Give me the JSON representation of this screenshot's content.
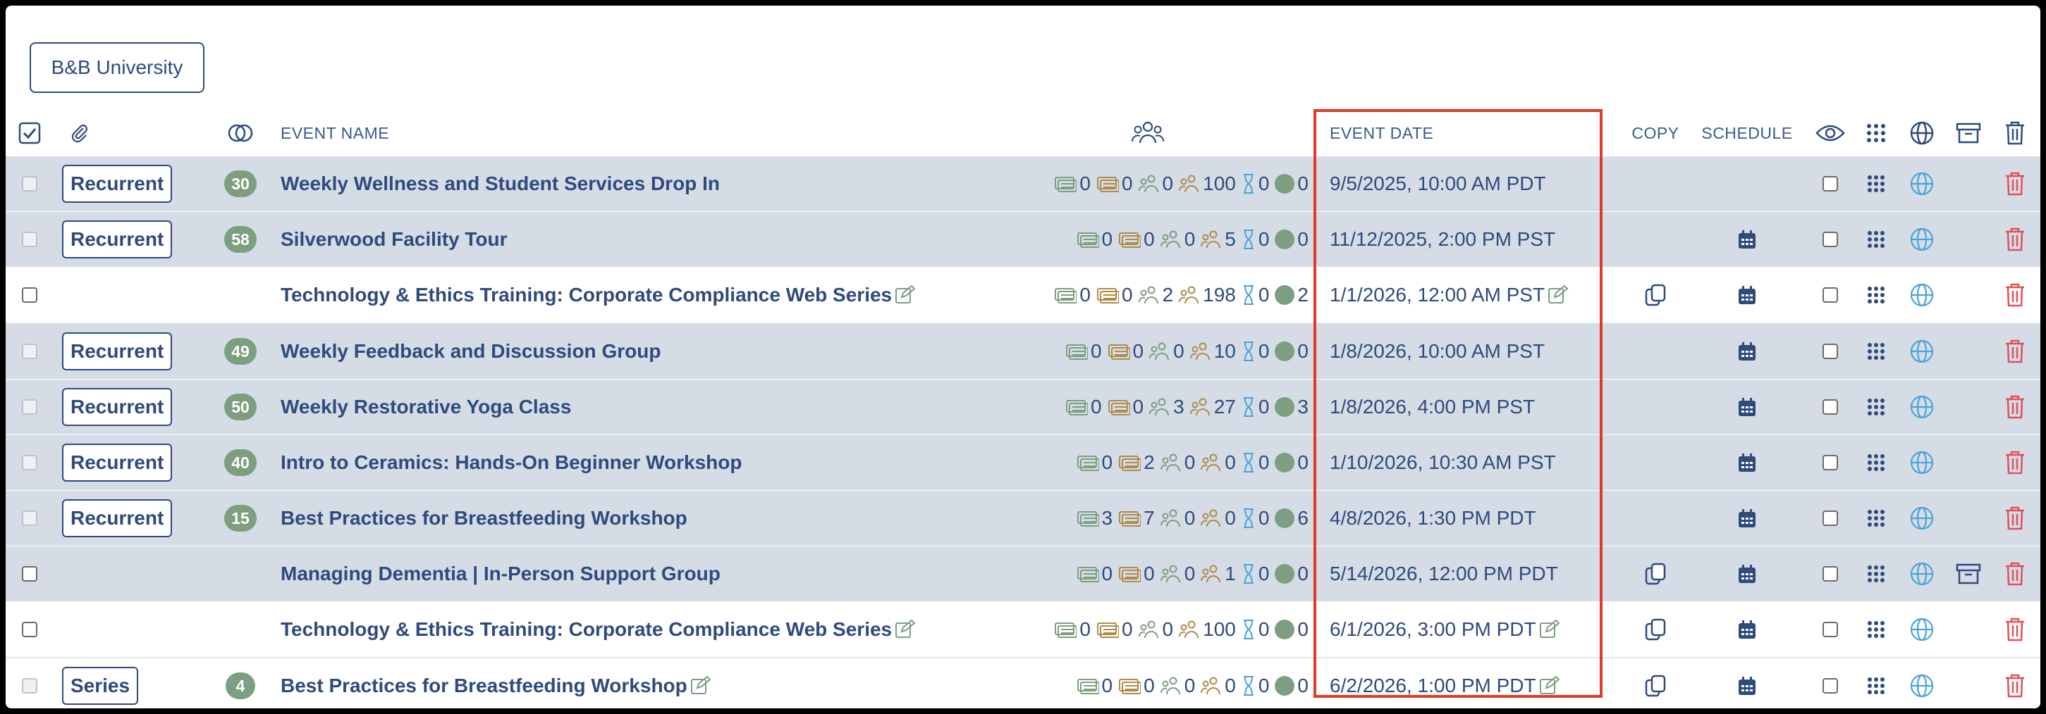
{
  "org_button": "B&B University",
  "header": {
    "event_name": "EVENT NAME",
    "event_date": "EVENT DATE",
    "copy": "COPY",
    "schedule": "SCHEDULE"
  },
  "colors": {
    "primary": "#2f4a7d",
    "row_shaded": "#d5dce6",
    "badge_green": "#7d9e80",
    "highlight_red": "#e03a24",
    "trash_red": "#e0505a",
    "globe_blue": "#4aa3d8"
  },
  "icons": [
    "select-all-checkbox-icon",
    "paperclip-icon",
    "linked-circles-icon",
    "users-icon",
    "ticket-icon",
    "attendee-icon",
    "hourglass-icon",
    "edit-icon",
    "copy-icon",
    "calendar-icon",
    "eye-icon",
    "grid-dots-icon",
    "globe-icon",
    "archive-icon",
    "trash-icon"
  ],
  "rows": [
    {
      "type": "Recurrent",
      "count": "30",
      "name": "Weekly Wellness and Student Services Drop In",
      "name_edit": false,
      "stats": [
        "0",
        "0",
        "0",
        "100",
        "0",
        "0"
      ],
      "date": "9/5/2025, 10:00 AM PDT",
      "date_edit": false,
      "copy": false,
      "schedule": false,
      "archive": false,
      "shaded": true,
      "dim_check": true
    },
    {
      "type": "Recurrent",
      "count": "58",
      "name": "Silverwood Facility Tour",
      "name_edit": false,
      "stats": [
        "0",
        "0",
        "0",
        "5",
        "0",
        "0"
      ],
      "date": "11/12/2025, 2:00 PM PST",
      "date_edit": false,
      "copy": false,
      "schedule": true,
      "archive": false,
      "shaded": true,
      "dim_check": true
    },
    {
      "type": "",
      "count": "",
      "name": "Technology & Ethics Training: Corporate Compliance Web Series",
      "name_edit": true,
      "stats": [
        "0",
        "0",
        "2",
        "198",
        "0",
        "2"
      ],
      "date": "1/1/2026, 12:00 AM PST",
      "date_edit": true,
      "copy": true,
      "schedule": true,
      "archive": false,
      "shaded": false,
      "dim_check": false
    },
    {
      "type": "Recurrent",
      "count": "49",
      "name": "Weekly Feedback and Discussion Group",
      "name_edit": false,
      "stats": [
        "0",
        "0",
        "0",
        "10",
        "0",
        "0"
      ],
      "date": "1/8/2026, 10:00 AM PST",
      "date_edit": false,
      "copy": false,
      "schedule": true,
      "archive": false,
      "shaded": true,
      "dim_check": true
    },
    {
      "type": "Recurrent",
      "count": "50",
      "name": "Weekly Restorative Yoga Class",
      "name_edit": false,
      "stats": [
        "0",
        "0",
        "3",
        "27",
        "0",
        "3"
      ],
      "date": "1/8/2026, 4:00 PM PST",
      "date_edit": false,
      "copy": false,
      "schedule": true,
      "archive": false,
      "shaded": true,
      "dim_check": true
    },
    {
      "type": "Recurrent",
      "count": "40",
      "name": "Intro to Ceramics: Hands-On Beginner Workshop",
      "name_edit": false,
      "stats": [
        "0",
        "2",
        "0",
        "0",
        "0",
        "0"
      ],
      "date": "1/10/2026, 10:30 AM PST",
      "date_edit": false,
      "copy": false,
      "schedule": true,
      "archive": false,
      "shaded": true,
      "dim_check": true
    },
    {
      "type": "Recurrent",
      "count": "15",
      "name": "Best Practices for Breastfeeding Workshop",
      "name_edit": false,
      "stats": [
        "3",
        "7",
        "0",
        "0",
        "0",
        "6"
      ],
      "date": "4/8/2026, 1:30 PM PDT",
      "date_edit": false,
      "copy": false,
      "schedule": true,
      "archive": false,
      "shaded": true,
      "dim_check": true
    },
    {
      "type": "",
      "count": "",
      "name": "Managing Dementia | In-Person Support Group",
      "name_edit": false,
      "stats": [
        "0",
        "0",
        "0",
        "1",
        "0",
        "0"
      ],
      "date": "5/14/2026, 12:00 PM PDT",
      "date_edit": false,
      "copy": true,
      "schedule": true,
      "archive": true,
      "shaded": true,
      "dim_check": false
    },
    {
      "type": "",
      "count": "",
      "name": "Technology & Ethics Training: Corporate Compliance Web Series",
      "name_edit": true,
      "stats": [
        "0",
        "0",
        "0",
        "100",
        "0",
        "0"
      ],
      "date": "6/1/2026, 3:00 PM PDT",
      "date_edit": true,
      "copy": true,
      "schedule": true,
      "archive": false,
      "shaded": false,
      "dim_check": false
    },
    {
      "type": "Series",
      "count": "4",
      "name": "Best Practices for Breastfeeding Workshop",
      "name_edit": true,
      "stats": [
        "0",
        "0",
        "0",
        "0",
        "0",
        "0"
      ],
      "date": "6/2/2026, 1:00 PM PDT",
      "date_edit": true,
      "copy": true,
      "schedule": true,
      "archive": false,
      "shaded": false,
      "dim_check": true
    }
  ]
}
